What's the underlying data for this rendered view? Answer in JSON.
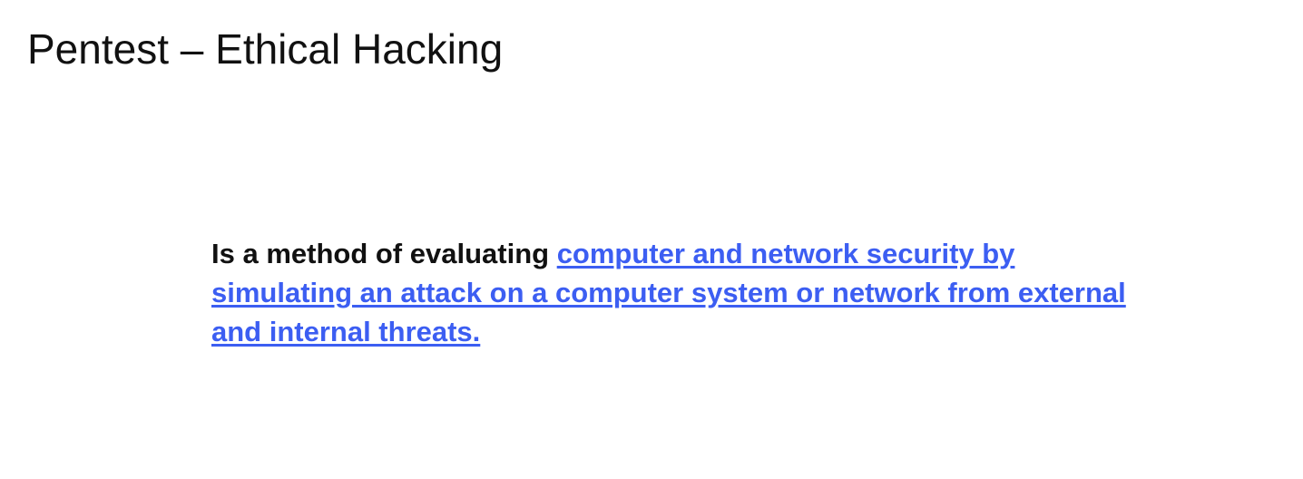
{
  "slide": {
    "title": "Pentest – Ethical Hacking",
    "body": {
      "lead_text": "Is a method of evaluating",
      "link_text": "computer and network security by simulating an attack on a computer system or network from external and internal threats.",
      "link_color": "#3c5ef2"
    }
  }
}
